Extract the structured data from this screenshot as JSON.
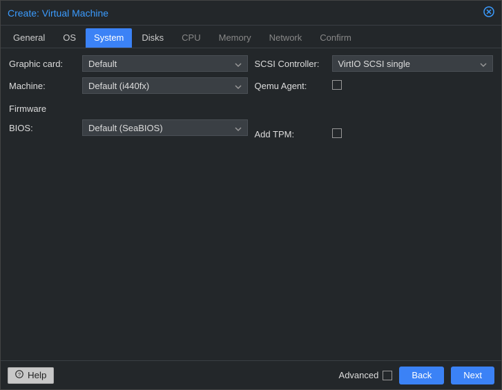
{
  "dialog": {
    "title": "Create: Virtual Machine"
  },
  "tabs": [
    {
      "label": "General",
      "active": false,
      "disabled": false
    },
    {
      "label": "OS",
      "active": false,
      "disabled": false
    },
    {
      "label": "System",
      "active": true,
      "disabled": false
    },
    {
      "label": "Disks",
      "active": false,
      "disabled": false
    },
    {
      "label": "CPU",
      "active": false,
      "disabled": true
    },
    {
      "label": "Memory",
      "active": false,
      "disabled": true
    },
    {
      "label": "Network",
      "active": false,
      "disabled": true
    },
    {
      "label": "Confirm",
      "active": false,
      "disabled": true
    }
  ],
  "form": {
    "left": {
      "graphic_card": {
        "label": "Graphic card:",
        "value": "Default"
      },
      "machine": {
        "label": "Machine:",
        "value": "Default (i440fx)"
      },
      "firmware_header": "Firmware",
      "bios": {
        "label": "BIOS:",
        "value": "Default (SeaBIOS)"
      }
    },
    "right": {
      "scsi_controller": {
        "label": "SCSI Controller:",
        "value": "VirtIO SCSI single"
      },
      "qemu_agent": {
        "label": "Qemu Agent:",
        "checked": false
      },
      "add_tpm": {
        "label": "Add TPM:",
        "checked": false
      }
    }
  },
  "footer": {
    "help": "Help",
    "advanced": "Advanced",
    "advanced_checked": false,
    "back": "Back",
    "next": "Next"
  }
}
